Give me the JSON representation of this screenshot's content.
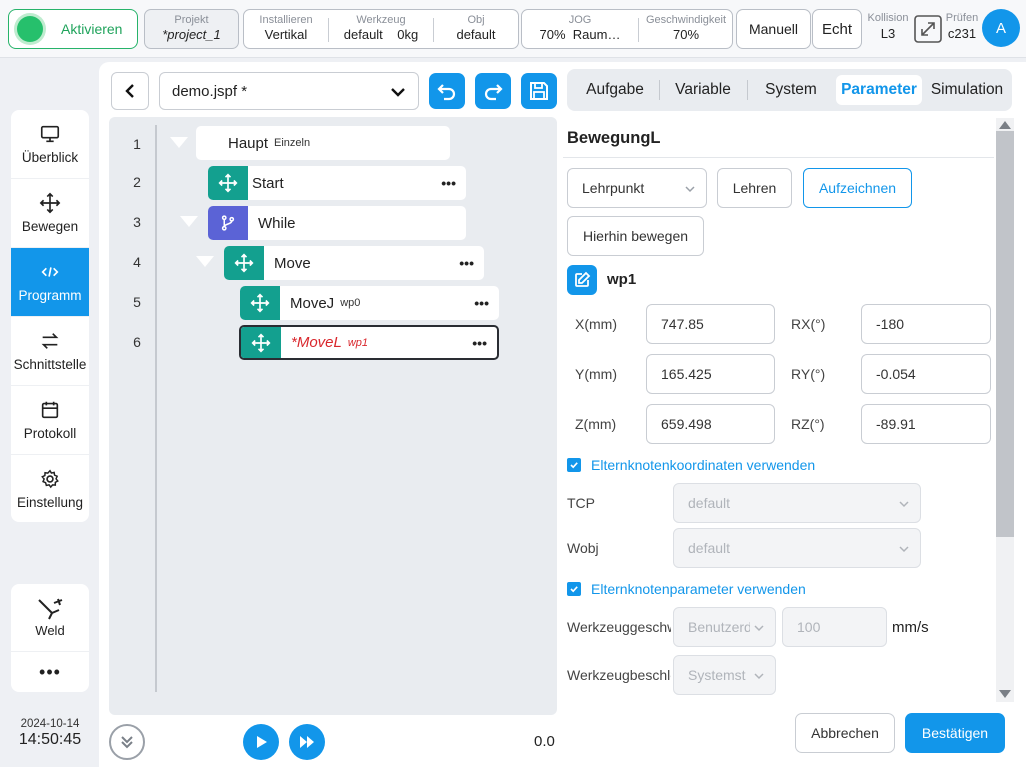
{
  "topbar": {
    "activate_label": "Aktivieren",
    "project": {
      "title": "Projekt",
      "value": "*project_1"
    },
    "install": {
      "title": "Installieren",
      "value": "Vertikal"
    },
    "tool": {
      "title": "Werkzeug",
      "value": "default",
      "weight": "0kg"
    },
    "obj": {
      "title": "Obj",
      "value": "default"
    },
    "jog": {
      "title": "JOG",
      "value": "70%",
      "mode": "Raum…"
    },
    "speed": {
      "title": "Geschwindigkeit",
      "value": "70%"
    },
    "manual_label": "Manuell",
    "real_label": "Echt",
    "collision": {
      "title": "Kollision",
      "value": "L3"
    },
    "check": {
      "title": "Prüfen",
      "value": "c231"
    },
    "avatar_letter": "A"
  },
  "nav": {
    "items": [
      {
        "label": "Überblick",
        "icon": "monitor-icon"
      },
      {
        "label": "Bewegen",
        "icon": "move-icon"
      },
      {
        "label": "Programm",
        "icon": "code-icon"
      },
      {
        "label": "Schnittstelle",
        "icon": "swap-icon"
      },
      {
        "label": "Protokoll",
        "icon": "calendar-icon"
      },
      {
        "label": "Einstellung",
        "icon": "gear-icon"
      }
    ],
    "weld_label": "Weld",
    "more_label": "•••"
  },
  "clock": {
    "date": "2024-10-14",
    "time": "14:50:45"
  },
  "editor": {
    "file_name": "demo.jspf *",
    "lines": [
      "1",
      "2",
      "3",
      "4",
      "5",
      "6"
    ],
    "nodes": [
      {
        "label": "Haupt",
        "sub": "Einzeln"
      },
      {
        "label": "Start",
        "sub": ""
      },
      {
        "label": "While",
        "sub": ""
      },
      {
        "label": "Move",
        "sub": ""
      },
      {
        "label": "MoveJ",
        "sub": "wp0"
      },
      {
        "label": "*MoveL",
        "sub": "wp1"
      }
    ],
    "dots": "•••",
    "speed_value": "0.0"
  },
  "panel": {
    "tabs": [
      "Aufgabe",
      "Variable",
      "System",
      "Parameter",
      "Simulation"
    ],
    "active_tab": "Parameter",
    "title": "BewegungL",
    "teach_point_select": "Lehrpunkt",
    "teach_button": "Lehren",
    "record_button": "Aufzeichnen",
    "move_here_button": "Hierhin bewegen",
    "waypoint_name": "wp1",
    "fields": {
      "x_label": "X(mm)",
      "x_value": "747.85",
      "y_label": "Y(mm)",
      "y_value": "165.425",
      "z_label": "Z(mm)",
      "z_value": "659.498",
      "rx_label": "RX(°)",
      "rx_value": "-180",
      "ry_label": "RY(°)",
      "ry_value": "-0.054",
      "rz_label": "RZ(°)",
      "rz_value": "-89.91"
    },
    "use_parent_coords": "Elternknotenkoordinaten verwenden",
    "tcp_label": "TCP",
    "tcp_value": "default",
    "wobj_label": "Wobj",
    "wobj_value": "default",
    "use_parent_params": "Elternknotenparameter verwenden",
    "tool_speed_label": "Werkzeuggeschw",
    "tool_speed_mode": "Benutzerd",
    "tool_speed_value": "100",
    "tool_speed_unit": "mm/s",
    "tool_accel_label": "Werkzeugbeschle",
    "tool_accel_mode": "Systemst",
    "cancel_button": "Abbrechen",
    "confirm_button": "Bestätigen"
  },
  "colors": {
    "accent": "#1296ea",
    "active_green": "#26c06c",
    "move_node": "#13a08f",
    "while_node": "#5b63d6",
    "selected_text": "#d9262c"
  }
}
